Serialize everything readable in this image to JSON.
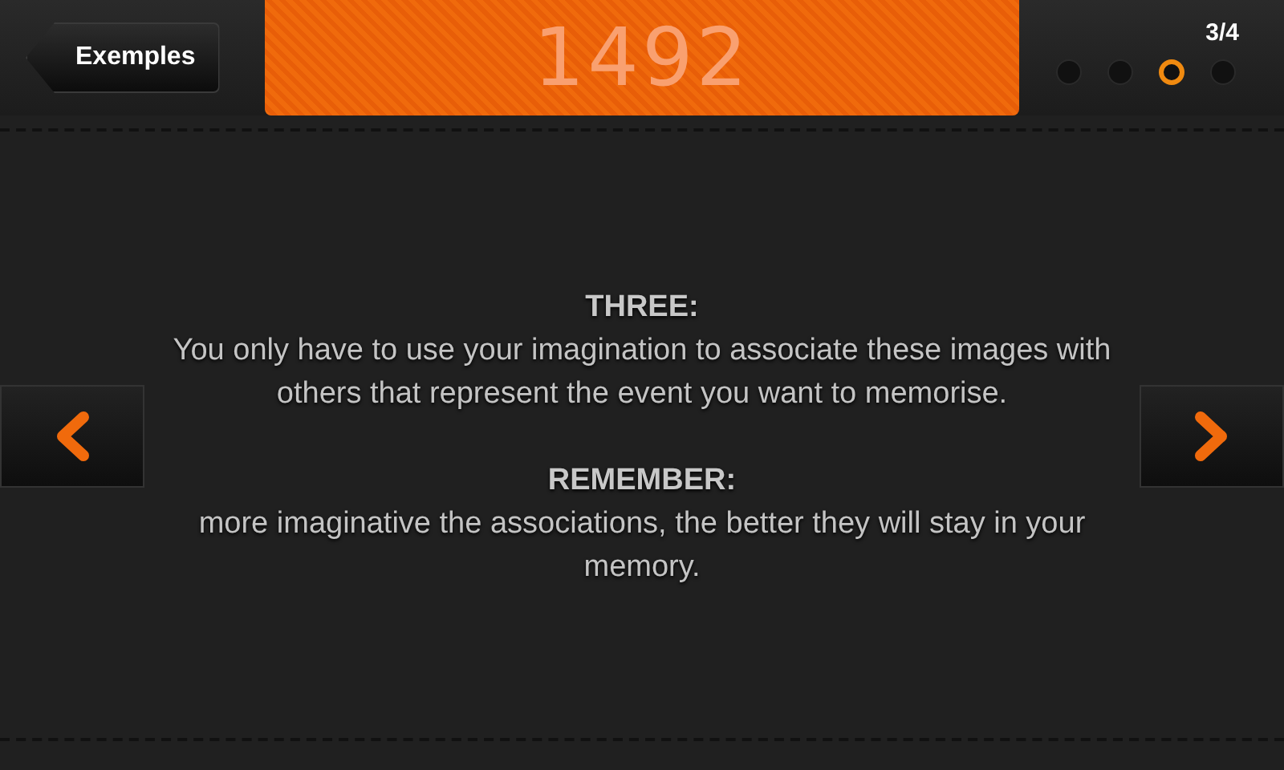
{
  "back_button": {
    "label": "Exemples"
  },
  "year": "1492",
  "page_indicator": {
    "label": "3/4",
    "dots": [
      {
        "selected": false
      },
      {
        "selected": false
      },
      {
        "selected": true
      },
      {
        "selected": false
      }
    ]
  },
  "sections": [
    {
      "heading": "THREE:",
      "body": "You only have to use your imagination to associate these images with others that represent the event you want to memorise."
    },
    {
      "heading": "REMEMBER:",
      "body": "more imaginative the associations, the better they will stay in your memory."
    }
  ]
}
